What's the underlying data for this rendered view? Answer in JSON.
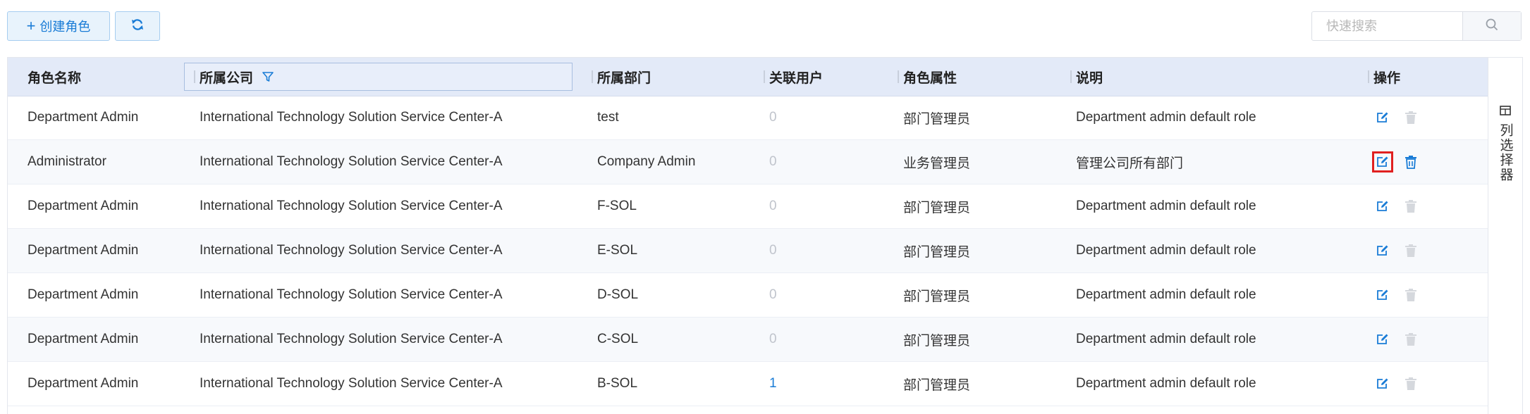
{
  "toolbar": {
    "create_label": "创建角色",
    "search_placeholder": "快速搜索"
  },
  "columns": {
    "role_name": "角色名称",
    "company": "所属公司",
    "department": "所属部门",
    "linked_users": "关联用户",
    "role_attr": "角色属性",
    "description": "说明",
    "actions": "操作"
  },
  "column_selector": "列选择器",
  "rows": [
    {
      "role_name": "Department Admin",
      "company": "International Technology Solution Service Center-A",
      "department": "test",
      "users": "0",
      "attr": "部门管理员",
      "desc": "Department admin default role"
    },
    {
      "role_name": "Administrator",
      "company": "International Technology Solution Service Center-A",
      "department": "Company Admin",
      "users": "0",
      "attr": "业务管理员",
      "desc": "管理公司所有部门"
    },
    {
      "role_name": "Department Admin",
      "company": "International Technology Solution Service Center-A",
      "department": "F-SOL",
      "users": "0",
      "attr": "部门管理员",
      "desc": "Department admin default role"
    },
    {
      "role_name": "Department Admin",
      "company": "International Technology Solution Service Center-A",
      "department": "E-SOL",
      "users": "0",
      "attr": "部门管理员",
      "desc": "Department admin default role"
    },
    {
      "role_name": "Department Admin",
      "company": "International Technology Solution Service Center-A",
      "department": "D-SOL",
      "users": "0",
      "attr": "部门管理员",
      "desc": "Department admin default role"
    },
    {
      "role_name": "Department Admin",
      "company": "International Technology Solution Service Center-A",
      "department": "C-SOL",
      "users": "0",
      "attr": "部门管理员",
      "desc": "Department admin default role"
    },
    {
      "role_name": "Department Admin",
      "company": "International Technology Solution Service Center-A",
      "department": "B-SOL",
      "users": "1",
      "attr": "部门管理员",
      "desc": "Department admin default role"
    }
  ],
  "colors": {
    "accent": "#1a7cd6",
    "header_bg": "#e3eaf8",
    "highlight": "#e02020",
    "muted": "#c0c4cc"
  }
}
